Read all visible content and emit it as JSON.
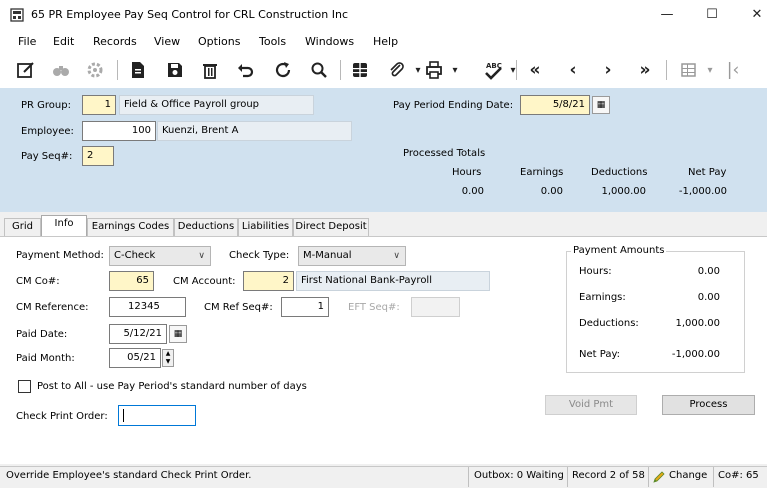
{
  "window": {
    "title": "65 PR Employee Pay Seq Control for CRL Construction Inc",
    "minimize": "—",
    "maximize": "☐",
    "close": "✕"
  },
  "menu": [
    "File",
    "Edit",
    "Records",
    "View",
    "Options",
    "Tools",
    "Windows",
    "Help"
  ],
  "toolbar_icons": [
    "edit-icon",
    "find-icon",
    "settings-icon",
    "new-icon",
    "save-icon",
    "delete-icon",
    "undo-icon",
    "refresh-icon",
    "search-icon",
    "grid-view-icon",
    "attach-icon",
    "print-icon",
    "spellcheck-icon",
    "first-record-icon",
    "previous-record-icon",
    "next-record-icon",
    "last-record-icon",
    "table-options-icon",
    "collapse-icon"
  ],
  "header": {
    "pr_group_label": "PR Group:",
    "pr_group_value": "1",
    "pr_group_desc": "Field & Office Payroll group",
    "employee_label": "Employee:",
    "employee_value": "100",
    "employee_name": "Kuenzi, Brent A",
    "pay_seq_label": "Pay Seq#:",
    "pay_seq_value": "2",
    "pay_period_label": "Pay Period Ending Date:",
    "pay_period_value": "5/8/21",
    "processed_totals_label": "Processed Totals",
    "totals_headers": [
      "Hours",
      "Earnings",
      "Deductions",
      "Net Pay"
    ],
    "totals_values": [
      "0.00",
      "0.00",
      "1,000.00",
      "-1,000.00"
    ]
  },
  "tabs": [
    "Grid",
    "Info",
    "Earnings Codes",
    "Deductions",
    "Liabilities",
    "Direct Deposit"
  ],
  "active_tab": "Info",
  "info": {
    "payment_method_label": "Payment Method:",
    "payment_method_value": "C-Check",
    "check_type_label": "Check Type:",
    "check_type_value": "M-Manual",
    "cm_co_label": "CM Co#:",
    "cm_co_value": "65",
    "cm_account_label": "CM Account:",
    "cm_account_value": "2",
    "cm_account_desc": "First National Bank-Payroll",
    "cm_reference_label": "CM Reference:",
    "cm_reference_value": "12345",
    "cm_ref_seq_label": "CM Ref Seq#:",
    "cm_ref_seq_value": "1",
    "eft_seq_label": "EFT Seq#:",
    "eft_seq_value": "",
    "paid_date_label": "Paid Date:",
    "paid_date_value": "5/12/21",
    "paid_month_label": "Paid Month:",
    "paid_month_value": "05/21",
    "post_to_all_label": "Post to All - use Pay Period's standard number of days",
    "check_print_order_label": "Check Print Order:",
    "check_print_order_value": ""
  },
  "payment_amounts": {
    "title": "Payment Amounts",
    "hours_label": "Hours:",
    "hours_value": "0.00",
    "earnings_label": "Earnings:",
    "earnings_value": "0.00",
    "deductions_label": "Deductions:",
    "deductions_value": "1,000.00",
    "net_pay_label": "Net Pay:",
    "net_pay_value": "-1,000.00"
  },
  "buttons": {
    "void_pmt": "Void Pmt",
    "process": "Process"
  },
  "status": {
    "message": "Override Employee's standard Check Print Order.",
    "outbox": "Outbox: 0 Waiting",
    "record": "Record 2 of 58",
    "mode": "Change",
    "company": "Co#: 65"
  }
}
